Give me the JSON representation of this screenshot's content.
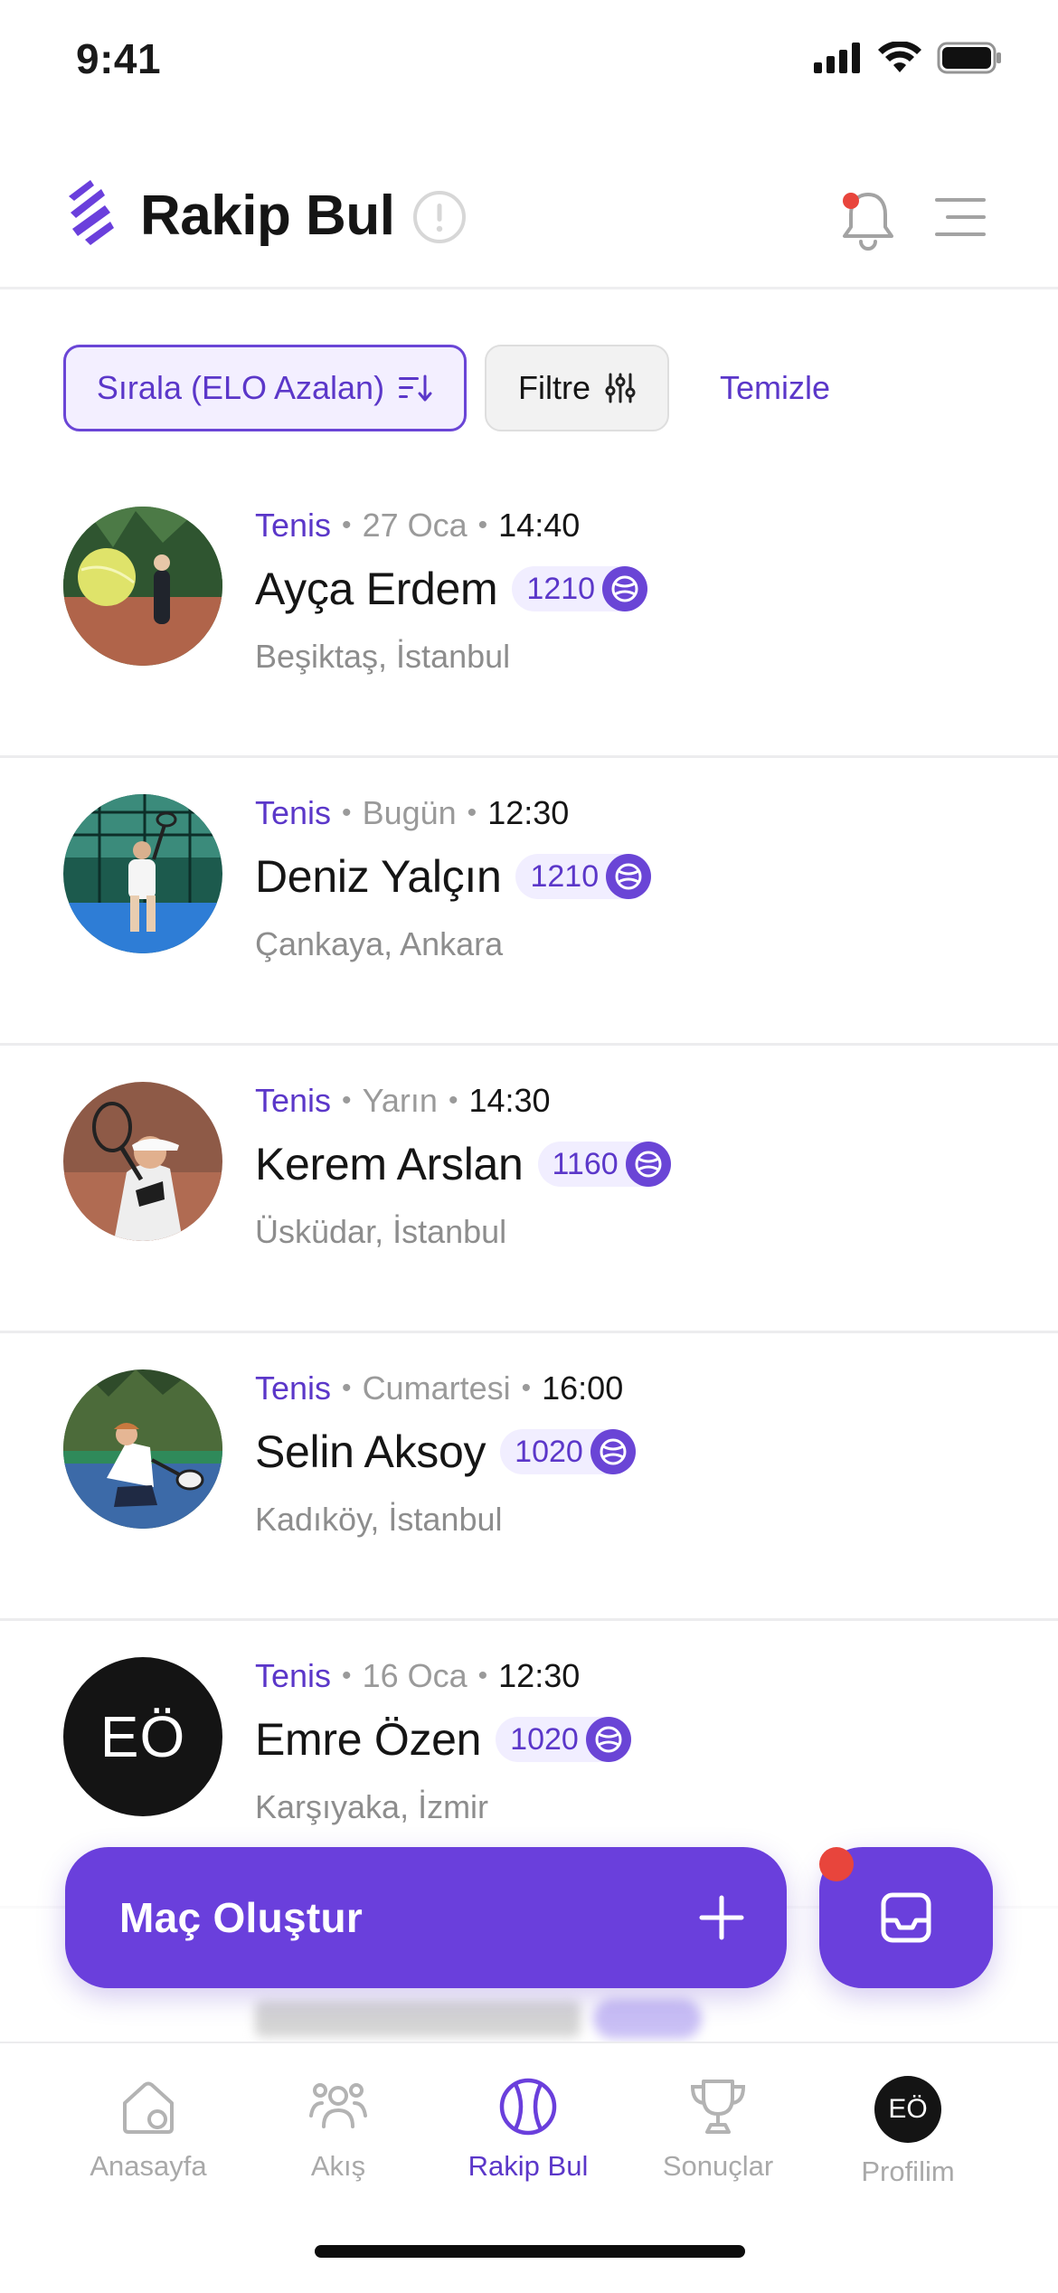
{
  "status": {
    "time": "9:41"
  },
  "header": {
    "title": "Rakip Bul"
  },
  "filters": {
    "sort_label": "Sırala (ELO Azalan)",
    "filter_label": "Filtre",
    "clear_label": "Temizle"
  },
  "players": [
    {
      "sport": "Tenis",
      "date": "27 Oca",
      "time": "14:40",
      "name": "Ayça Erdem",
      "elo": "1210",
      "location": "Beşiktaş, İstanbul"
    },
    {
      "sport": "Tenis",
      "date": "Bugün",
      "time": "12:30",
      "name": "Deniz Yalçın",
      "elo": "1210",
      "location": "Çankaya, Ankara"
    },
    {
      "sport": "Tenis",
      "date": "Yarın",
      "time": "14:30",
      "name": "Kerem Arslan",
      "elo": "1160",
      "location": "Üsküdar, İstanbul"
    },
    {
      "sport": "Tenis",
      "date": "Cumartesi",
      "time": "16:00",
      "name": "Selin Aksoy",
      "elo": "1020",
      "location": "Kadıköy, İstanbul"
    },
    {
      "sport": "Tenis",
      "date": "16 Oca",
      "time": "12:30",
      "name": "Emre Özen",
      "elo": "1020",
      "location": "Karşıyaka, İzmir",
      "initials": "EÖ"
    }
  ],
  "actions": {
    "create_label": "Maç Oluştur"
  },
  "tabs": [
    {
      "label": "Anasayfa",
      "icon": "home-icon"
    },
    {
      "label": "Akış",
      "icon": "people-icon"
    },
    {
      "label": "Rakip Bul",
      "icon": "tennis-ball-icon",
      "active": true
    },
    {
      "label": "Sonuçlar",
      "icon": "trophy-icon"
    },
    {
      "label": "Profilim",
      "icon": "avatar",
      "initials": "EÖ"
    }
  ],
  "colors": {
    "accent": "#6a3fdc",
    "alert": "#e8453c"
  }
}
